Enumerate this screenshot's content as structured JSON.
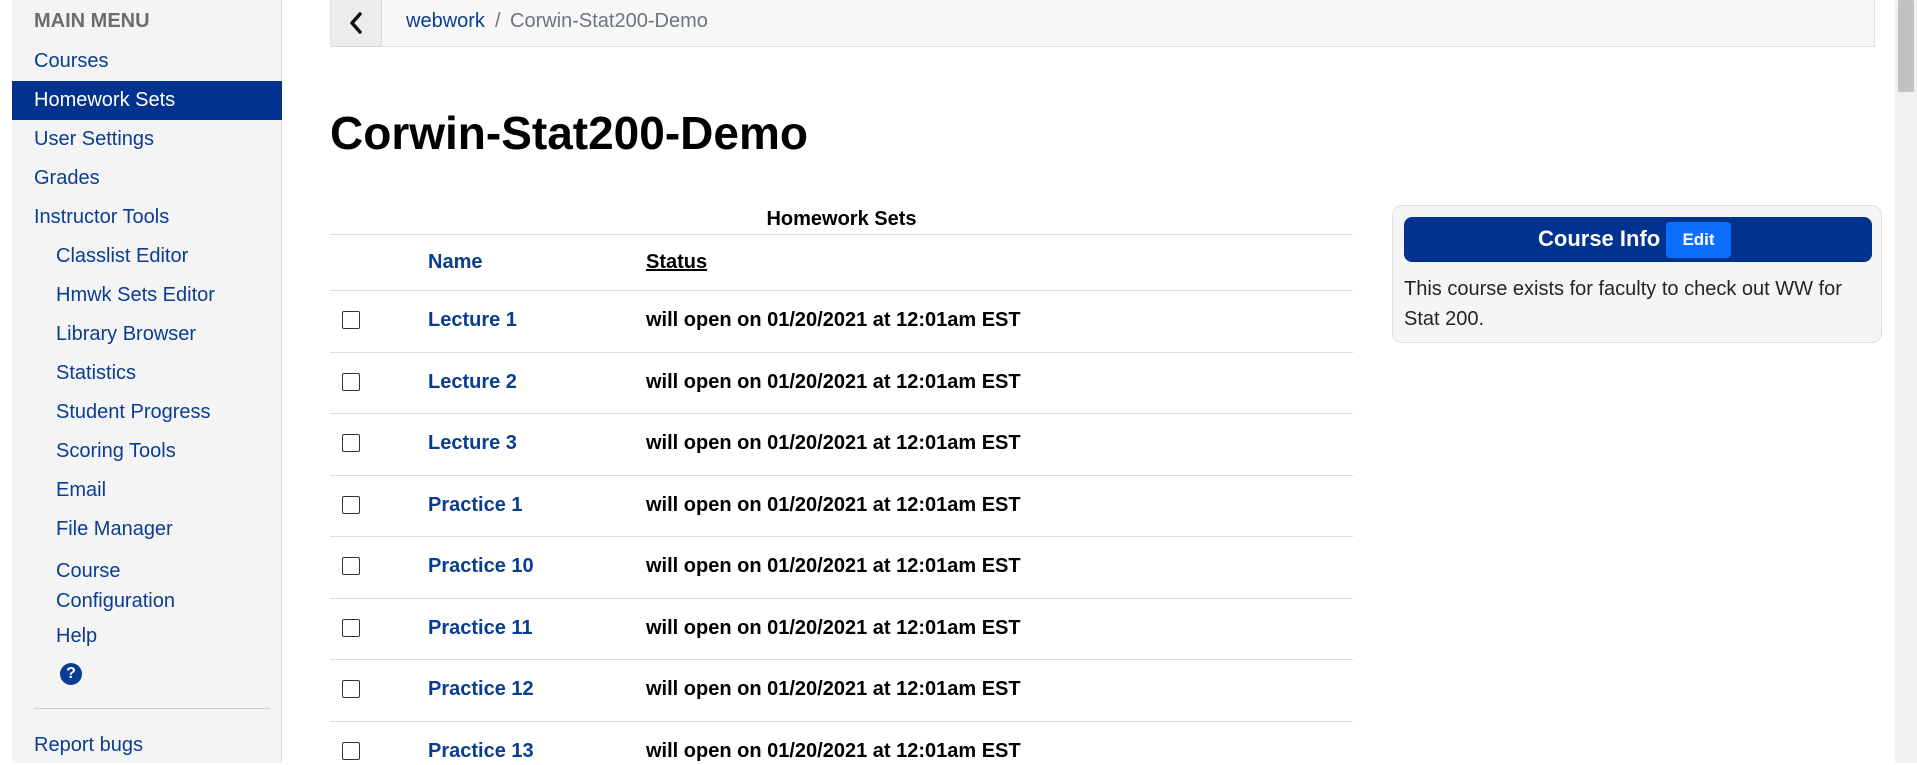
{
  "sidebar": {
    "header": "MAIN MENU",
    "items": [
      {
        "label": "Courses"
      },
      {
        "label": "Homework Sets",
        "active": true
      },
      {
        "label": "User Settings"
      },
      {
        "label": "Grades"
      },
      {
        "label": "Instructor Tools"
      },
      {
        "label": "Classlist Editor",
        "sub": true
      },
      {
        "label": "Hmwk Sets Editor",
        "sub": true
      },
      {
        "label": "Library Browser",
        "sub": true
      },
      {
        "label": "Statistics",
        "sub": true
      },
      {
        "label": "Student Progress",
        "sub": true
      },
      {
        "label": "Scoring Tools",
        "sub": true
      },
      {
        "label": "Email",
        "sub": true
      },
      {
        "label": "File Manager",
        "sub": true
      },
      {
        "label_line1": "Course",
        "label_line2": "Configuration",
        "sub": true
      },
      {
        "label": "Help",
        "sub": true
      },
      {
        "label": "Report bugs"
      }
    ],
    "help_icon_glyph": "?"
  },
  "breadcrumb": {
    "root": "webwork",
    "separator": "/",
    "current": "Corwin-Stat200-Demo"
  },
  "page_title": "Corwin-Stat200-Demo",
  "homework_table": {
    "caption": "Homework Sets",
    "columns": {
      "name": "Name",
      "status": "Status"
    },
    "rows": [
      {
        "name": "Lecture 1",
        "status": "will open on 01/20/2021 at 12:01am EST"
      },
      {
        "name": "Lecture 2",
        "status": "will open on 01/20/2021 at 12:01am EST"
      },
      {
        "name": "Lecture 3",
        "status": "will open on 01/20/2021 at 12:01am EST"
      },
      {
        "name": "Practice 1",
        "status": "will open on 01/20/2021 at 12:01am EST"
      },
      {
        "name": "Practice 10",
        "status": "will open on 01/20/2021 at 12:01am EST"
      },
      {
        "name": "Practice 11",
        "status": "will open on 01/20/2021 at 12:01am EST"
      },
      {
        "name": "Practice 12",
        "status": "will open on 01/20/2021 at 12:01am EST"
      },
      {
        "name": "Practice 13",
        "status": "will open on 01/20/2021 at 12:01am EST"
      }
    ]
  },
  "course_info": {
    "title": "Course Info",
    "edit_label": "Edit",
    "text": "This course exists for faculty to check out WW for Stat 200."
  },
  "colors": {
    "primary_navy": "#01328e",
    "link_blue": "#0a3d91",
    "edit_blue": "#0d6efd"
  }
}
